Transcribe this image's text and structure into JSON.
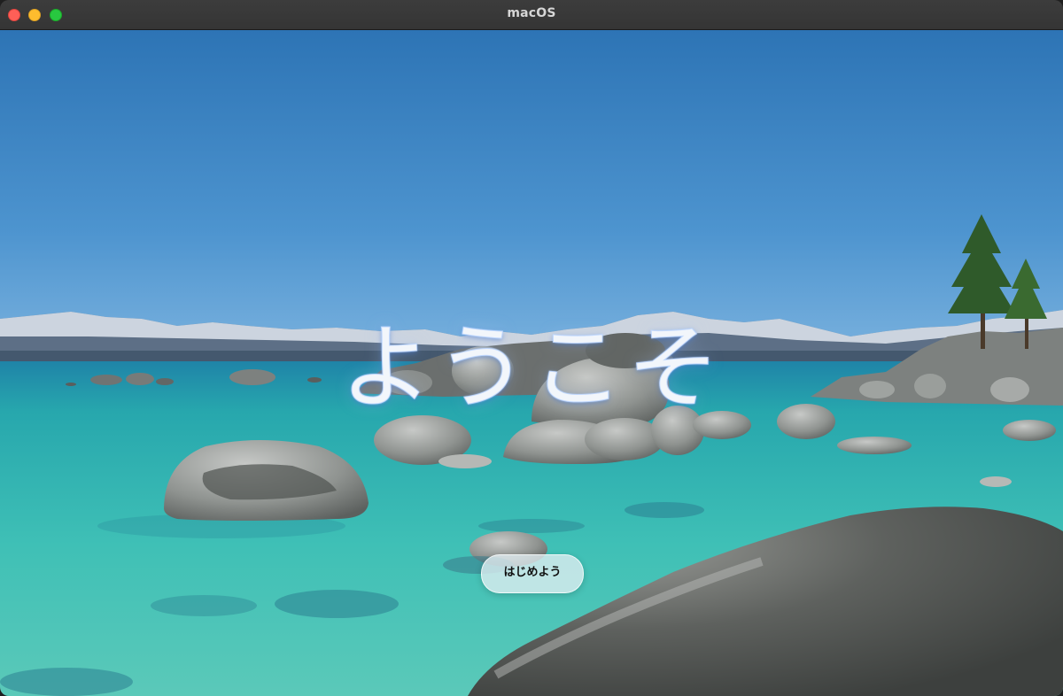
{
  "window": {
    "title": "macOS"
  },
  "welcome": {
    "heading": "ようこそ",
    "start_button_label": "はじめよう"
  },
  "colors": {
    "titlebar": "#3a3a3a",
    "close": "#fe5f57",
    "minimize": "#febc2e",
    "zoom": "#28c840",
    "sky_top": "#2f77b8",
    "water": "#2fb7b0"
  }
}
